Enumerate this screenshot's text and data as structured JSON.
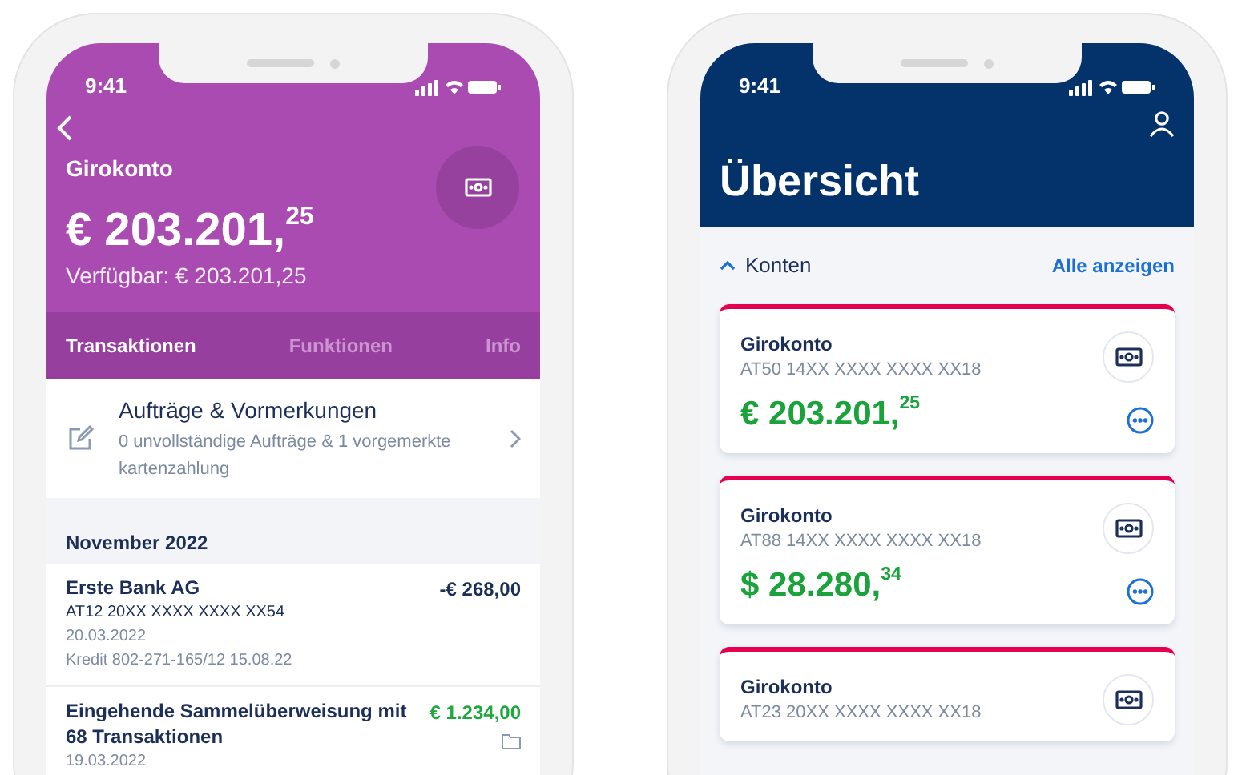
{
  "account_screen": {
    "status_time": "9:41",
    "title": "Girokonto",
    "balance": "€ 203.201,$^{25}$",
    "available": "Verfügbar: € 203.201,25",
    "tabs": [
      {
        "label": "Transaktionen",
        "selected": true
      },
      {
        "label": "Funktionen",
        "selected": false
      },
      {
        "label": "Info",
        "selected": false
      }
    ],
    "orders": {
      "title": "Aufträge & Vormerkungen",
      "subtitle": "0 unvollständige Aufträge & 1 vorgemerkte kartenzahlung"
    },
    "section": "November 2022",
    "transactions": [
      {
        "kind": "debit",
        "title": "Erste Bank AG",
        "amount": "-€ 268,00",
        "folder": false,
        "lines": [
          "AT12 20XX XXXX XXXX XX54",
          "20.03.2022",
          "Kredit 802-271-165/12 15.08.22"
        ]
      },
      {
        "kind": "credit",
        "title": "Eingehende Sammelüberweisung mit 68 Transaktionen",
        "amount": "€ 1.234,00",
        "folder": true,
        "lines": [
          "19.03.2022"
        ]
      }
    ]
  },
  "overview_screen": {
    "status_time": "9:41",
    "title": "Übersicht",
    "section": {
      "label": "Konten",
      "expanded": true
    },
    "show_all": "Alle anzeigen",
    "accounts": [
      {
        "name": "Girokonto",
        "iban": "AT50 14XX XXXX XXXX XX18",
        "balance": "€ 203.201,$^{25}$"
      },
      {
        "name": "Girokonto",
        "iban": "AT88 14XX XXXX XXXX XX18",
        "balance": "$ 28.280,$^{34}$"
      },
      {
        "name": "Girokonto",
        "iban": "AT23 20XX XXXX XXXX XX18"
      }
    ]
  }
}
